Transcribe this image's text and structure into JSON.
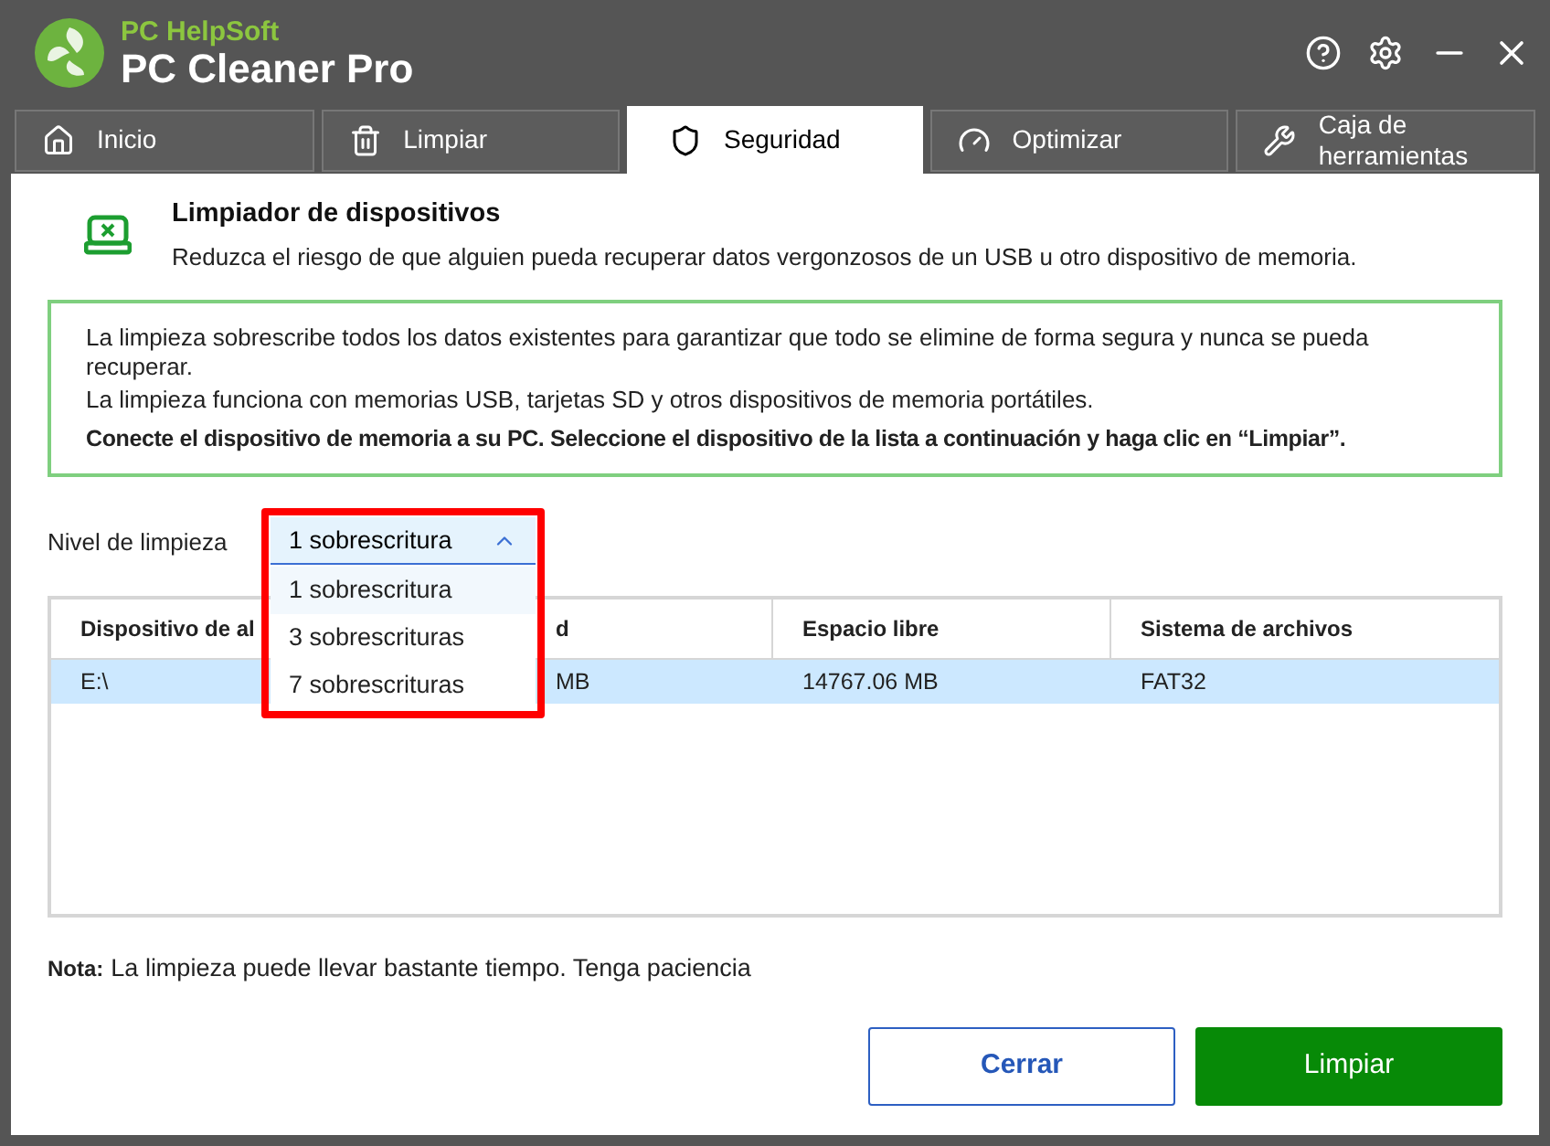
{
  "window": {
    "brand": "PC HelpSoft",
    "title": "PC Cleaner Pro"
  },
  "tabs": [
    {
      "label": "Inicio",
      "selected": false
    },
    {
      "label": "Limpiar",
      "selected": false
    },
    {
      "label": "Seguridad",
      "selected": true
    },
    {
      "label": "Optimizar",
      "selected": false
    },
    {
      "label": "Caja de herramientas",
      "selected": false
    }
  ],
  "header": {
    "title": "Limpiador de dispositivos",
    "subtitle": "Reduzca el riesgo de que alguien pueda recuperar datos vergonzosos de un USB u otro dispositivo de memoria."
  },
  "info": [
    "La limpieza sobrescribe todos los datos existentes para garantizar que todo se elimine de forma segura y nunca se pueda recuperar.",
    "La limpieza funciona con memorias USB, tarjetas SD y otros dispositivos de memoria portátiles."
  ],
  "instruction": "Conecte el dispositivo de memoria a su PC. Seleccione el dispositivo de la lista a continuación y haga clic en “Limpiar”.",
  "level": {
    "label": "Nivel de limpieza",
    "value": "1 sobrescritura",
    "expanded": true,
    "options": [
      {
        "label": "1 sobrescritura",
        "selected": true
      },
      {
        "label": "3 sobrescrituras",
        "selected": false
      },
      {
        "label": "7 sobrescrituras",
        "selected": false
      }
    ]
  },
  "table": {
    "columns": [
      "Dispositivo de al",
      "d",
      "Espacio libre",
      "Sistema de archivos"
    ],
    "rows": [
      {
        "cells": [
          "E:\\",
          "MB",
          "14767.06 MB",
          "FAT32"
        ],
        "selected": true
      }
    ]
  },
  "note": {
    "label": "Nota:",
    "text": "La limpieza puede llevar bastante tiempo. Tenga paciencia"
  },
  "buttons": [
    {
      "label": "Cerrar",
      "kind": "secondary"
    },
    {
      "label": "Limpiar",
      "kind": "primary"
    }
  ]
}
